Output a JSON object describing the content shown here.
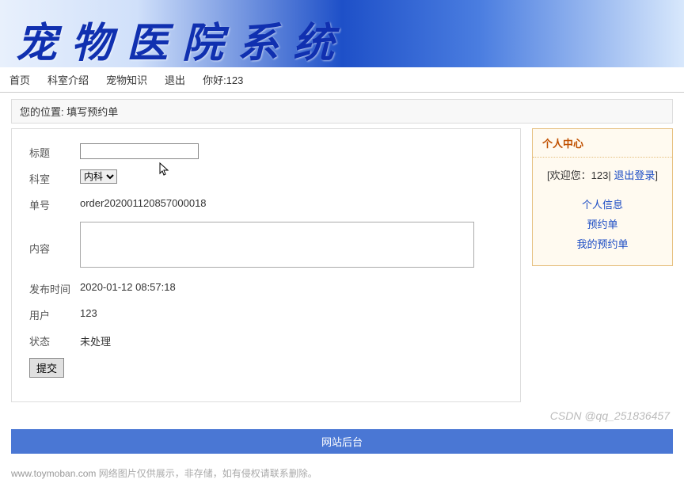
{
  "banner": {
    "title": "宠物医院系统"
  },
  "nav": {
    "home": "首页",
    "dept": "科室介绍",
    "knowledge": "宠物知识",
    "logout": "退出",
    "greeting": "你好:123"
  },
  "breadcrumb": {
    "prefix": "您的位置:",
    "page": "填写预约单"
  },
  "form": {
    "title_label": "标题",
    "title_value": "",
    "dept_label": "科室",
    "dept_value": "内科",
    "order_label": "单号",
    "order_value": "order202001120857000018",
    "content_label": "内容",
    "content_value": "",
    "publish_label": "发布时间",
    "publish_value": "2020-01-12 08:57:18",
    "user_label": "用户",
    "user_value": "123",
    "status_label": "状态",
    "status_value": "未处理",
    "submit_label": "提交"
  },
  "sidebar": {
    "header": "个人中心",
    "welcome_prefix": "[欢迎您：",
    "welcome_user": "123",
    "welcome_sep": "| ",
    "logout_link": "退出登录",
    "welcome_suffix": "]",
    "links": {
      "profile": "个人信息",
      "reserve": "预约单",
      "myreserve": "我的预约单"
    }
  },
  "footer": {
    "backend": "网站后台"
  },
  "disclaimer": {
    "site": "www.toymoban.com",
    "text": " 网络图片仅供展示，非存储，如有侵权请联系删除。"
  },
  "watermark": "CSDN @qq_251836457"
}
